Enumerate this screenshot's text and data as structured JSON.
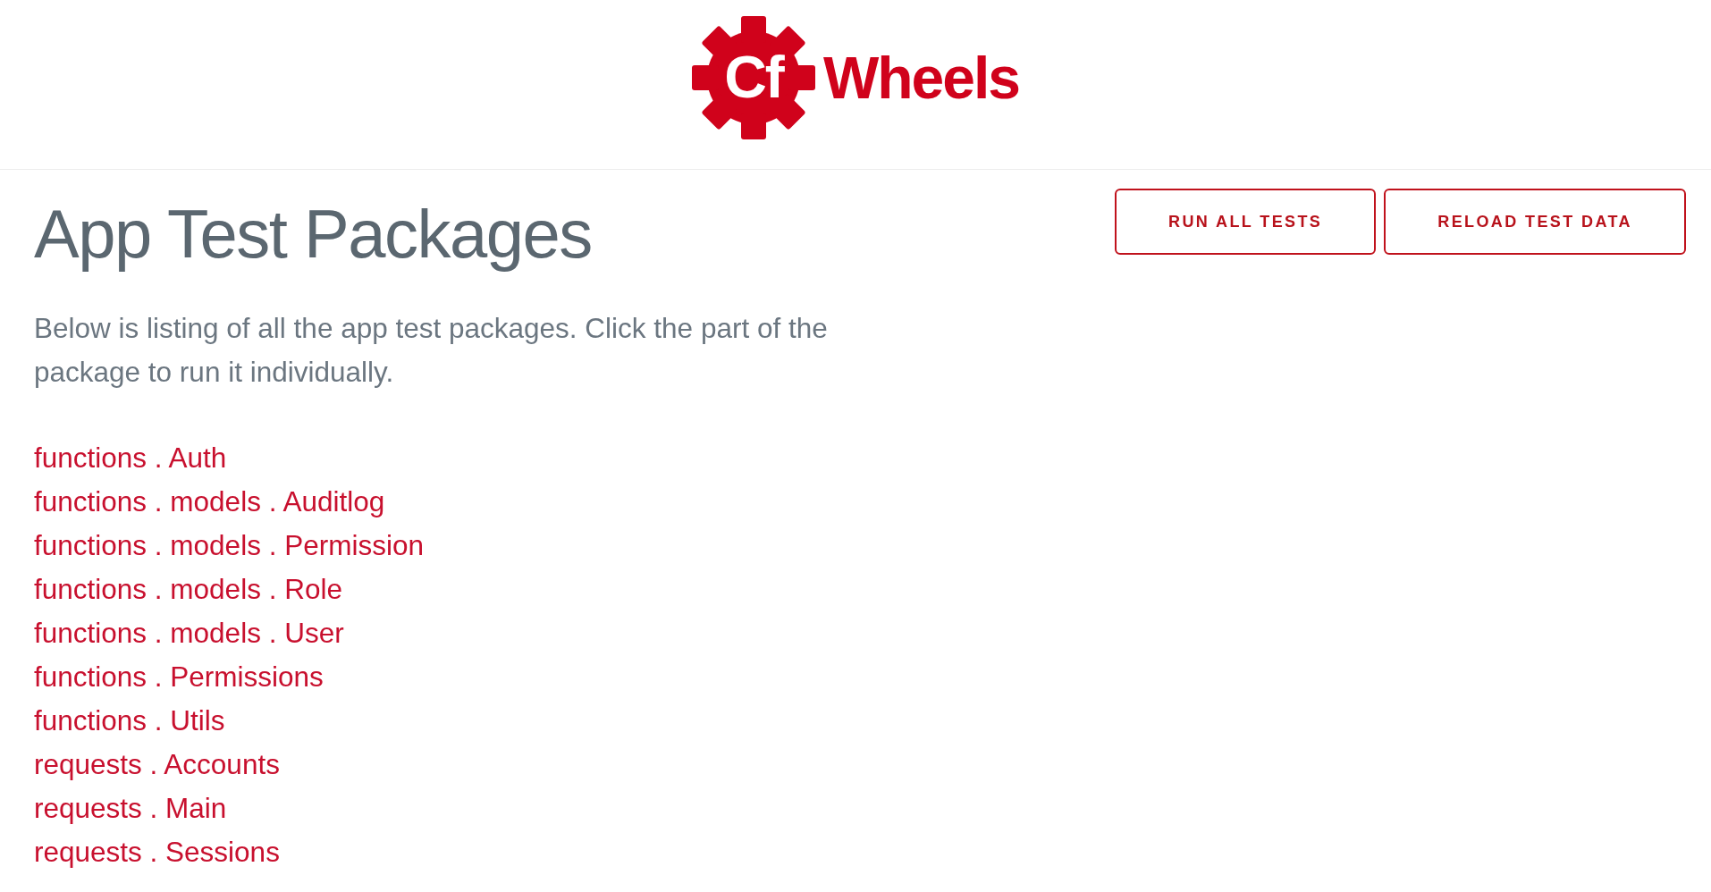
{
  "header": {
    "logo": {
      "mark": "Cf",
      "name": "Wheels"
    }
  },
  "page": {
    "title": "App Test Packages",
    "buttons": [
      "RUN ALL TESTS",
      "RELOAD TEST DATA"
    ],
    "intro": "Below is listing of all the app test packages. Click the part of the package to run it individually.",
    "packages": [
      "functions . Auth",
      "functions . models . Auditlog",
      "functions . models . Permission",
      "functions . models . Role",
      "functions . models . User",
      "functions . Permissions",
      "functions . Utils",
      "requests . Accounts",
      "requests . Main",
      "requests . Sessions"
    ]
  }
}
